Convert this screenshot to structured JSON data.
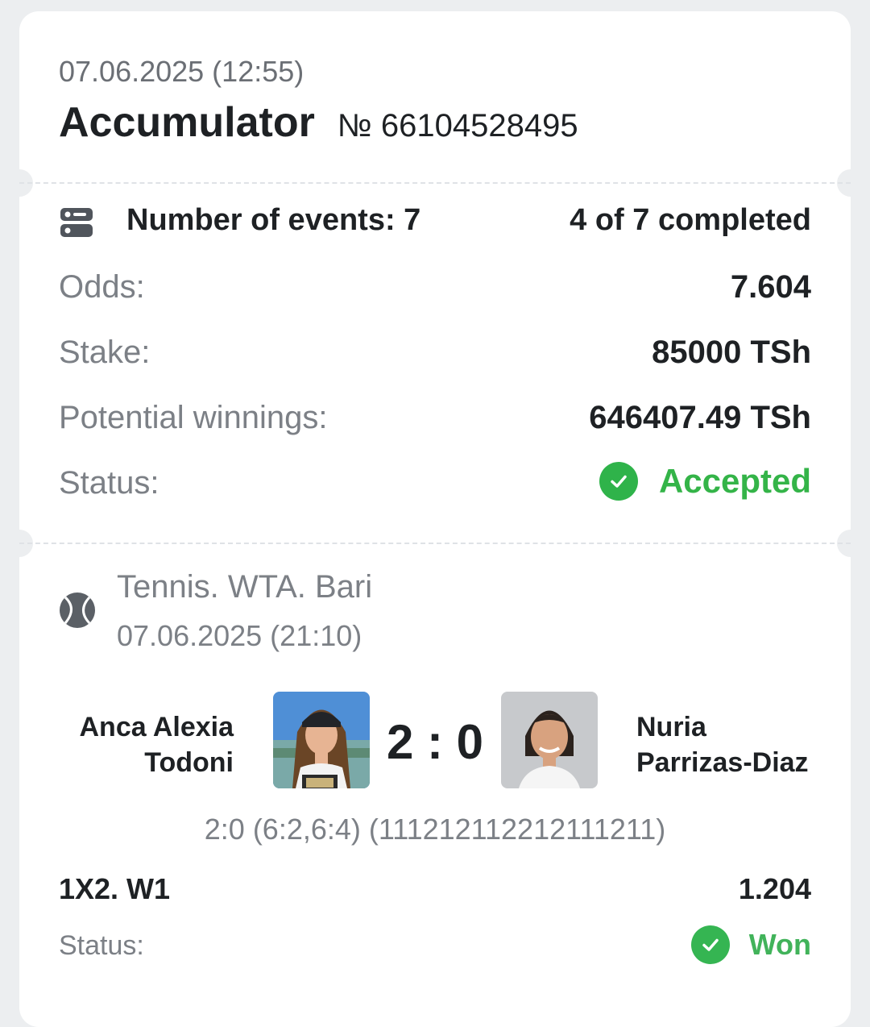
{
  "bet": {
    "date": "07.06.2025 (12:55)",
    "type": "Accumulator",
    "number": "№ 66104528495",
    "events_label": "Number of events: 7",
    "completed": "4 of 7 completed",
    "odds_label": "Odds:",
    "odds_value": "7.604",
    "stake_label": "Stake:",
    "stake_value": "85000 TSh",
    "winnings_label": "Potential winnings:",
    "winnings_value": "646407.49 TSh",
    "status_label": "Status:",
    "status_value": "Accepted"
  },
  "event": {
    "league": "Tennis. WTA. Bari",
    "date": "07.06.2025 (21:10)",
    "player1_line1": "Anca Alexia",
    "player1_line2": "Todoni",
    "player2_line1": "Nuria",
    "player2_line2": "Parrizas-Diaz",
    "score": "2 : 0",
    "set_scores": "2:0 (6:2,6:4) (111212112212111211)",
    "market": "1X2. W1",
    "market_odds": "1.204",
    "status_label": "Status:",
    "status_value": "Won"
  },
  "icons": {
    "events": "list-toggle-icon",
    "status_check": "check-circle-icon",
    "sport": "tennis-ball-icon"
  },
  "colors": {
    "accent_green": "#34b448",
    "text_dark": "#1e2124",
    "text_muted": "#7c8086",
    "background": "#eceef0"
  }
}
